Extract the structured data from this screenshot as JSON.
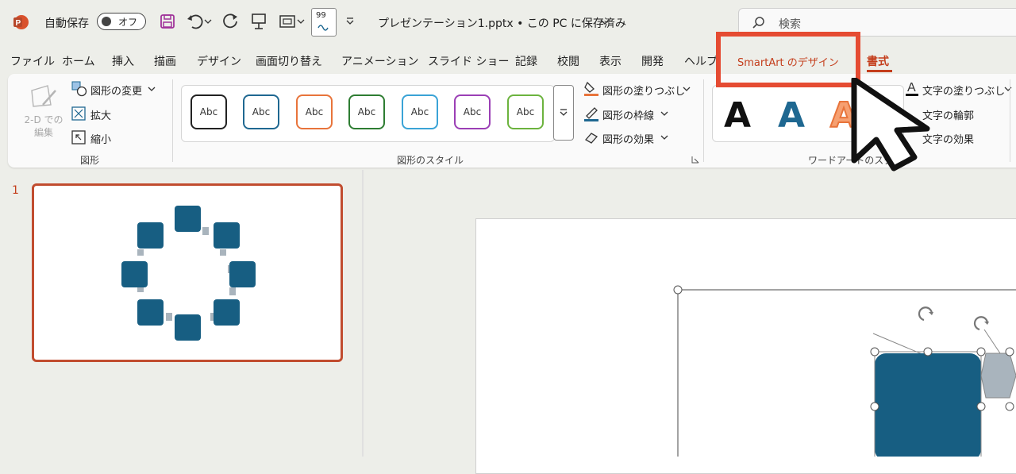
{
  "titlebar": {
    "app_icon": "powerpoint-icon",
    "autosave_label": "自動保存",
    "autosave_state": "オフ",
    "file_name": "プレゼンテーション1.pptx • この PC に保存済み",
    "search_placeholder": "検索",
    "quick_access_badge": "99"
  },
  "tabs": [
    "ファイル",
    "ホーム",
    "挿入",
    "描画",
    "デザイン",
    "画面切り替え",
    "アニメーション",
    "スライド ショー",
    "記録",
    "校閲",
    "表示",
    "開発",
    "ヘルプ",
    "SmartArt のデザイン",
    "書式"
  ],
  "active_tab": "書式",
  "highlighted_tab": "SmartArt のデザイン",
  "ribbon": {
    "shapes_group": {
      "edit_in_2d": "2-D での\n編集",
      "change_shape": "図形の変更",
      "larger": "拡大",
      "smaller": "縮小",
      "label": "図形"
    },
    "shape_styles_group": {
      "sample_text": "Abc",
      "style_colors": [
        "#222222",
        "#1f6891",
        "#e8743b",
        "#2e7d32",
        "#3aa3d6",
        "#9b3fb5",
        "#6cb33e"
      ],
      "fill": "図形の塗りつぶし",
      "outline": "図形の枠線",
      "effects": "図形の効果",
      "label": "図形のスタイル"
    },
    "wordart_group": {
      "sample_letter": "A",
      "text_fill": "文字の塗りつぶし",
      "text_outline": "文字の輪郭",
      "text_effects": "文字の効果",
      "label": "ワードアートのスタイル"
    }
  },
  "thumbnail_pane": {
    "slide_number": "1"
  },
  "colors": {
    "accent": "#c43e1c",
    "highlight_box": "#e54b32",
    "smartart_fill": "#175e82",
    "connector": "#a9b4bd"
  }
}
